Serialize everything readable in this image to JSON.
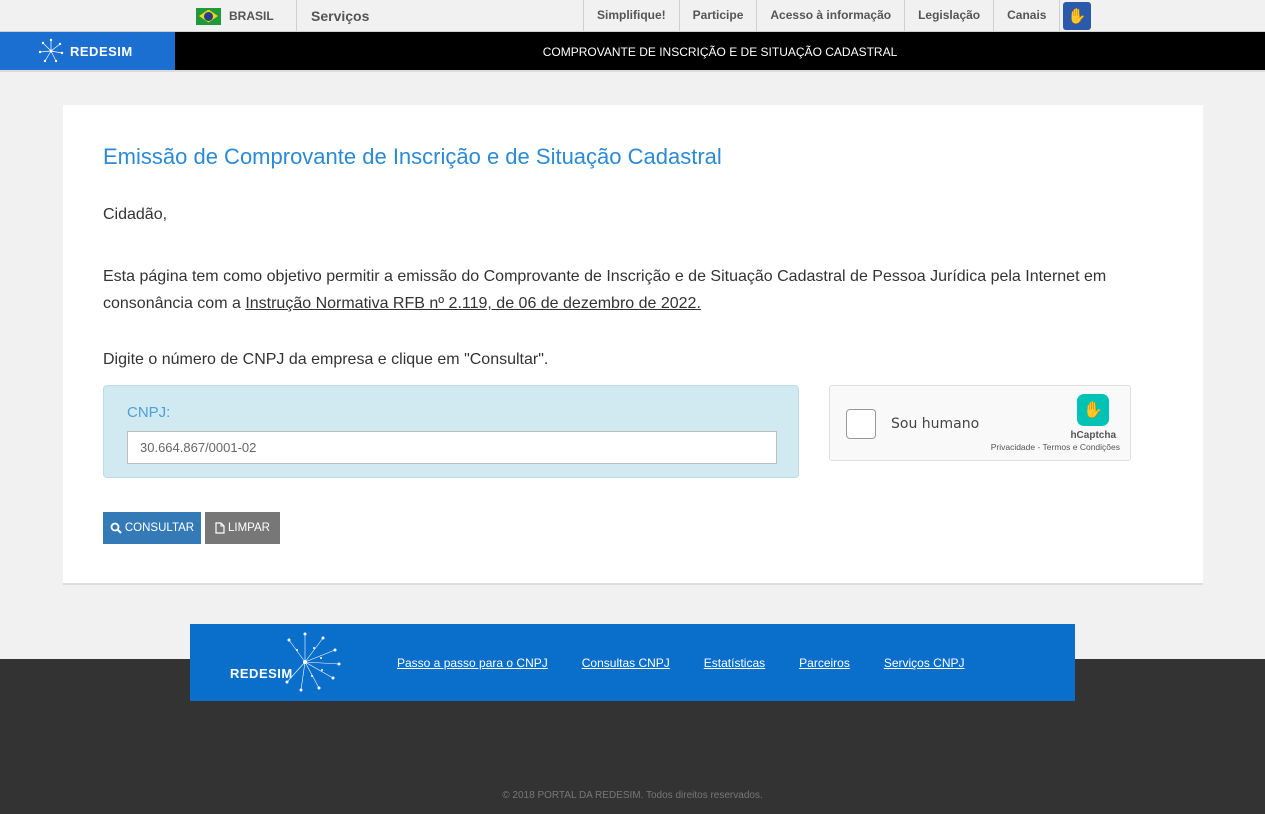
{
  "govbar": {
    "country": "BRASIL",
    "services": "Serviços",
    "links": [
      "Simplifique!",
      "Participe",
      "Acesso à informação",
      "Legislação",
      "Canais"
    ]
  },
  "header": {
    "logo": "REDESIM",
    "title": "COMPROVANTE DE INSCRIÇÃO E DE SITUAÇÃO CADASTRAL"
  },
  "main": {
    "title": "Emissão de Comprovante de Inscrição e de Situação Cadastral",
    "greeting": "Cidadão,",
    "paragraph_start": "Esta página tem como objetivo permitir a emissão do Comprovante de Inscrição e de Situação Cadastral de Pessoa Jurídica pela Internet em consonância com a ",
    "paragraph_link": "Instrução Normativa RFB nº 2.119, de 06 de dezembro de 2022.",
    "instruction": "Digite o número de CNPJ da empresa e clique em \"Consultar\".",
    "cnpj_label": "CNPJ:",
    "cnpj_value": "30.664.867/0001-02"
  },
  "captcha": {
    "label": "Sou humano",
    "brand": "hCaptcha",
    "links": "Privacidade - Termos e Condições"
  },
  "buttons": {
    "consultar": "CONSULTAR",
    "limpar": "LIMPAR"
  },
  "footer": {
    "logo": "REDESIM",
    "links": [
      "Passo a passo para o CNPJ",
      "Consultas CNPJ",
      "Estatísticas",
      "Parceiros",
      "Serviços CNPJ"
    ],
    "copyright": "2018 PORTAL DA REDESIM. Todos direitos reservados."
  },
  "colors": {
    "accent": "#2b8ad6",
    "header_blue": "#1a6fd0",
    "footer_blue": "#0a6ecb",
    "button_primary": "#337ab7",
    "button_secondary": "#777777"
  }
}
